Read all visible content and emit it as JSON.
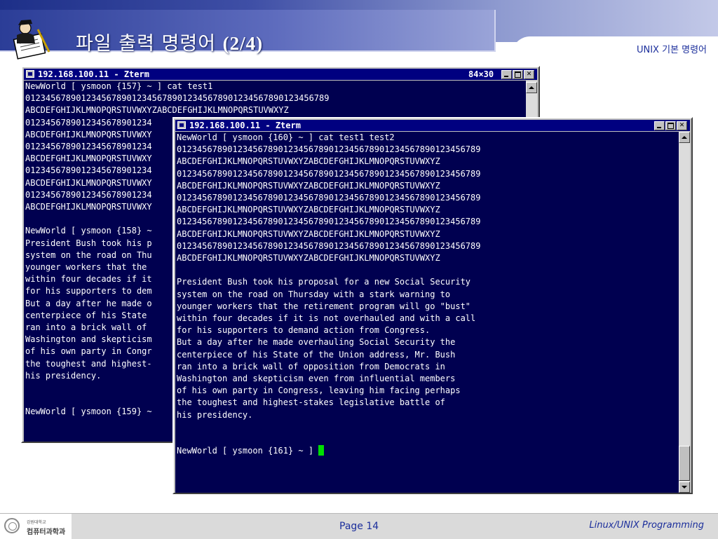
{
  "slide": {
    "title_korean": "파일 출력 명령어",
    "title_suffix": "(2/4)",
    "subtitle": "UNIX 기본 명령어"
  },
  "window_back": {
    "title": "192.168.100.11 - Zterm",
    "size": "84×30",
    "lines": [
      "NewWorld [ ysmoon {157} ~ ] cat test1",
      "012345678901234567890123456789012345678901234567890123456789",
      "ABCDEFGHIJKLMNOPQRSTUVWXYZABCDEFGHIJKLMNOPQRSTUVWXYZ",
      "0123456789012345678901234",
      "ABCDEFGHIJKLMNOPQRSTUVWXY",
      "0123456789012345678901234",
      "ABCDEFGHIJKLMNOPQRSTUVWXY",
      "0123456789012345678901234",
      "ABCDEFGHIJKLMNOPQRSTUVWXY",
      "0123456789012345678901234",
      "ABCDEFGHIJKLMNOPQRSTUVWXY",
      "",
      "NewWorld [ ysmoon {158} ~",
      "President Bush took his p",
      "system on the road on Thu",
      "younger workers that the",
      "within four decades if it",
      "for his supporters to dem",
      "But a day after he made o",
      "centerpiece of his State",
      "ran into a brick wall of",
      "Washington and skepticism",
      "of his own party in Congr",
      "the toughest and highest-",
      "his presidency.",
      "",
      "",
      "NewWorld [ ysmoon {159} ~"
    ]
  },
  "window_front": {
    "title": "192.168.100.11 - Zterm",
    "lines": [
      "NewWorld [ ysmoon {160} ~ ] cat test1 test2",
      "012345678901234567890123456789012345678901234567890123456789",
      "ABCDEFGHIJKLMNOPQRSTUVWXYZABCDEFGHIJKLMNOPQRSTUVWXYZ",
      "012345678901234567890123456789012345678901234567890123456789",
      "ABCDEFGHIJKLMNOPQRSTUVWXYZABCDEFGHIJKLMNOPQRSTUVWXYZ",
      "012345678901234567890123456789012345678901234567890123456789",
      "ABCDEFGHIJKLMNOPQRSTUVWXYZABCDEFGHIJKLMNOPQRSTUVWXYZ",
      "012345678901234567890123456789012345678901234567890123456789",
      "ABCDEFGHIJKLMNOPQRSTUVWXYZABCDEFGHIJKLMNOPQRSTUVWXYZ",
      "012345678901234567890123456789012345678901234567890123456789",
      "ABCDEFGHIJKLMNOPQRSTUVWXYZABCDEFGHIJKLMNOPQRSTUVWXYZ",
      "",
      "President Bush took his proposal for a new Social Security",
      "system on the road on Thursday with a stark warning to",
      "younger workers that the retirement program will go \"bust\"",
      "within four decades if it is not overhauled and with a call",
      "for his supporters to demand action from Congress.",
      "But a day after he made overhauling Social Security the",
      "centerpiece of his State of the Union address, Mr. Bush",
      "ran into a brick wall of opposition from Democrats in",
      "Washington and skepticism even from influential members",
      "of his own party in Congress, leaving him facing perhaps",
      "the toughest and highest-stakes legislative battle of",
      "his presidency.",
      "",
      ""
    ],
    "prompt": "NewWorld [ ysmoon {161} ~ ] "
  },
  "footer": {
    "university_small": "강원대학교",
    "department": "컴퓨터과학과",
    "page": "Page 14",
    "course": "Linux/UNIX Programming"
  },
  "colors": {
    "terminal_bg": "#000050",
    "titlebar": "#000080",
    "cursor": "#00e000",
    "accent_text": "#1c2f9c"
  },
  "icons": [
    "reader-logo",
    "window-icon",
    "minimize-icon",
    "maximize-icon",
    "close-icon",
    "scroll-up-icon",
    "scroll-down-icon",
    "university-emblem"
  ]
}
